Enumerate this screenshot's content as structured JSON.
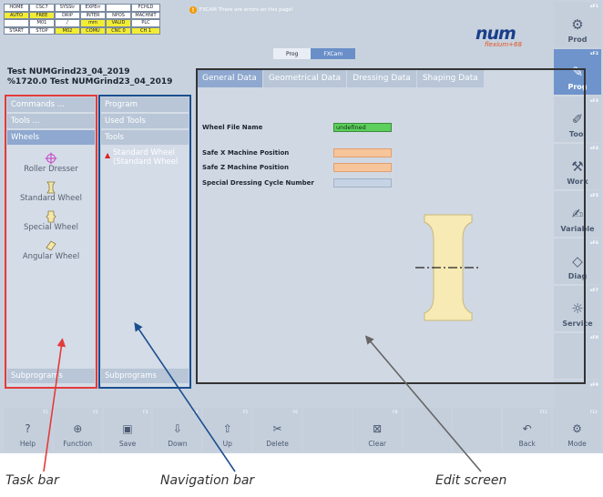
{
  "status": {
    "row1": [
      "HOME",
      "CSC7",
      "SYSStr",
      "EXPErr",
      "",
      "FCHLD"
    ],
    "row2": [
      "AUTO",
      "FREE",
      "DRIP",
      "INTER",
      "NPOS",
      "MACHNIT"
    ],
    "row3": [
      "",
      "M01",
      "/",
      "mm",
      "VALID",
      "PLC"
    ],
    "row4": [
      "START",
      "STOP",
      "M02",
      "COMU",
      "CNC 0",
      "CH 1"
    ]
  },
  "banner": {
    "icon": "warning-icon",
    "text": "FXCAM There are errors on this page!"
  },
  "logo": {
    "brand": "num",
    "sub": "flexium+68"
  },
  "mode_tabs": [
    "Prog",
    "FXCam"
  ],
  "program_title": [
    "Test NUMGrind23_04_2019",
    "%1720.0 Test NUMGrind23_04_2019"
  ],
  "taskbar": {
    "items": [
      "Commands ...",
      "Tools ...",
      "Wheels"
    ],
    "tools": [
      {
        "label": "Roller Dresser",
        "icon": "roller-dresser-icon"
      },
      {
        "label": "Standard Wheel",
        "icon": "standard-wheel-icon"
      },
      {
        "label": "Special Wheel",
        "icon": "special-wheel-icon"
      },
      {
        "label": "Angular Wheel",
        "icon": "angular-wheel-icon"
      }
    ],
    "bottom": "Subprograms"
  },
  "navbar": {
    "items": [
      "Program",
      "Used Tools",
      "Tools"
    ],
    "selected_line1": "Standard Wheel",
    "selected_line2": "(Standard Wheel",
    "bottom": "Subprograms"
  },
  "edit": {
    "tabs": [
      "General Data",
      "Geometrical Data",
      "Dressing Data",
      "Shaping Data"
    ],
    "fields": [
      {
        "label": "Wheel File Name",
        "value": "undefined",
        "style": "green"
      },
      {
        "label": "Safe X Machine Position",
        "value": "",
        "style": "orange"
      },
      {
        "label": "Safe Z Machine Position",
        "value": "",
        "style": "orange"
      },
      {
        "label": "Special Dressing Cycle Number",
        "value": "",
        "style": "blue"
      }
    ]
  },
  "side_buttons": [
    {
      "label": "Prod",
      "fk": "xF1",
      "icon": "prod-icon"
    },
    {
      "label": "Prog",
      "fk": "xF2",
      "icon": "prog-icon",
      "active": true
    },
    {
      "label": "Tool",
      "fk": "xF3",
      "icon": "tool-icon"
    },
    {
      "label": "Work",
      "fk": "xF4",
      "icon": "work-icon"
    },
    {
      "label": "Variable",
      "fk": "xF5",
      "icon": "variable-icon"
    },
    {
      "label": "Diag",
      "fk": "xF6",
      "icon": "diag-icon"
    },
    {
      "label": "Service",
      "fk": "xF7",
      "icon": "service-icon"
    },
    {
      "label": "",
      "fk": "xF8",
      "icon": ""
    },
    {
      "label": "",
      "fk": "xF9",
      "icon": ""
    }
  ],
  "bottom_buttons": [
    {
      "label": "Help",
      "fk": "F1",
      "icon": "help-icon"
    },
    {
      "label": "Function",
      "fk": "F2",
      "icon": "function-icon"
    },
    {
      "label": "Save",
      "fk": "F3",
      "icon": "save-icon"
    },
    {
      "label": "Down",
      "fk": "F4",
      "icon": "down-icon"
    },
    {
      "label": "Up",
      "fk": "F5",
      "icon": "up-icon"
    },
    {
      "label": "Delete",
      "fk": "F6",
      "icon": "delete-icon"
    },
    {
      "label": "",
      "fk": "",
      "icon": ""
    },
    {
      "label": "Clear",
      "fk": "F8",
      "icon": "clear-icon"
    },
    {
      "label": "",
      "fk": "",
      "icon": ""
    },
    {
      "label": "",
      "fk": "",
      "icon": ""
    },
    {
      "label": "Back",
      "fk": "F11",
      "icon": "back-icon"
    },
    {
      "label": "Mode",
      "fk": "F12",
      "icon": "mode-icon"
    }
  ],
  "captions": {
    "task_bar": "Task bar",
    "navigation_bar": "Navigation bar",
    "edit_screen": "Edit screen"
  },
  "colors": {
    "red_box": "#e33b3b",
    "blue_box": "#1b4e8f",
    "active_tab": "#8ea8cf",
    "accent": "#6f94cc"
  }
}
